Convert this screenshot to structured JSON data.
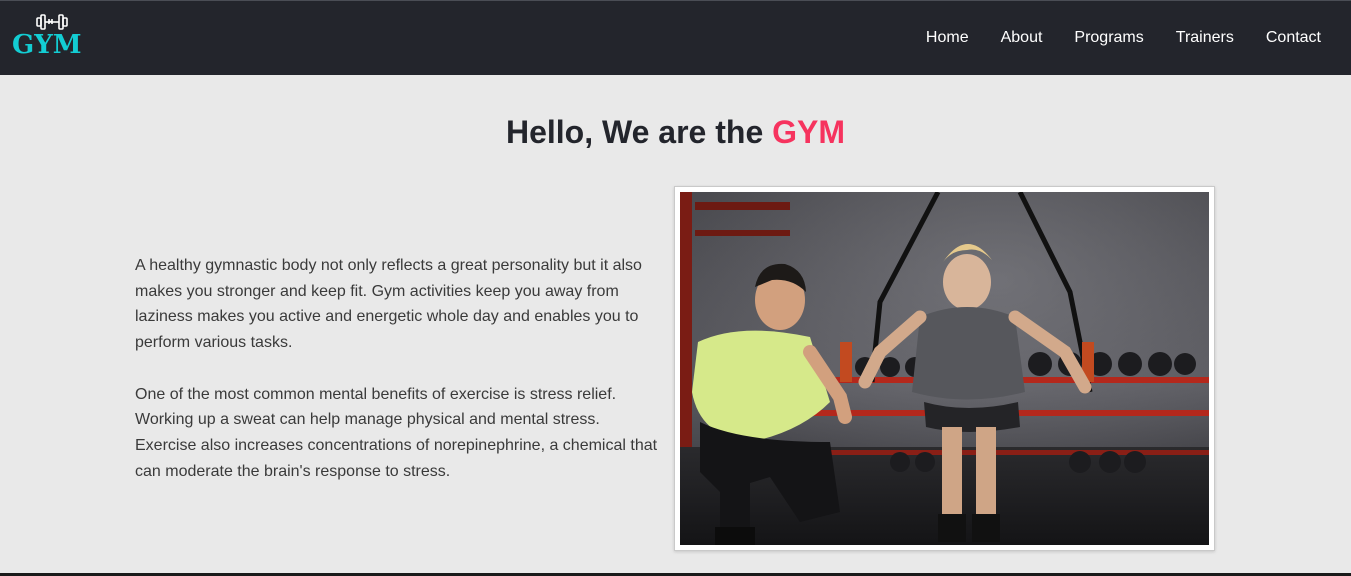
{
  "brand": {
    "name": "GYM",
    "icon": "dumbbell-icon",
    "color": "#13cdd3"
  },
  "nav": {
    "items": [
      {
        "label": "Home"
      },
      {
        "label": "About"
      },
      {
        "label": "Programs"
      },
      {
        "label": "Trainers"
      },
      {
        "label": "Contact"
      }
    ]
  },
  "hero": {
    "heading_prefix": "Hello, We are the ",
    "heading_accent": "GYM",
    "accent_color": "#f6335e",
    "paragraphs": [
      "A healthy gymnastic body not only reflects a great personality but it also makes you stronger and keep fit. Gym activities keep you away from laziness makes you active and energetic whole day and enables you to perform various tasks.",
      "One of the most common mental benefits of exercise is stress relief. Working up a sweat can help manage physical and mental stress. Exercise also increases concentrations of norepinephrine, a chemical that can moderate the brain's response to stress."
    ]
  }
}
